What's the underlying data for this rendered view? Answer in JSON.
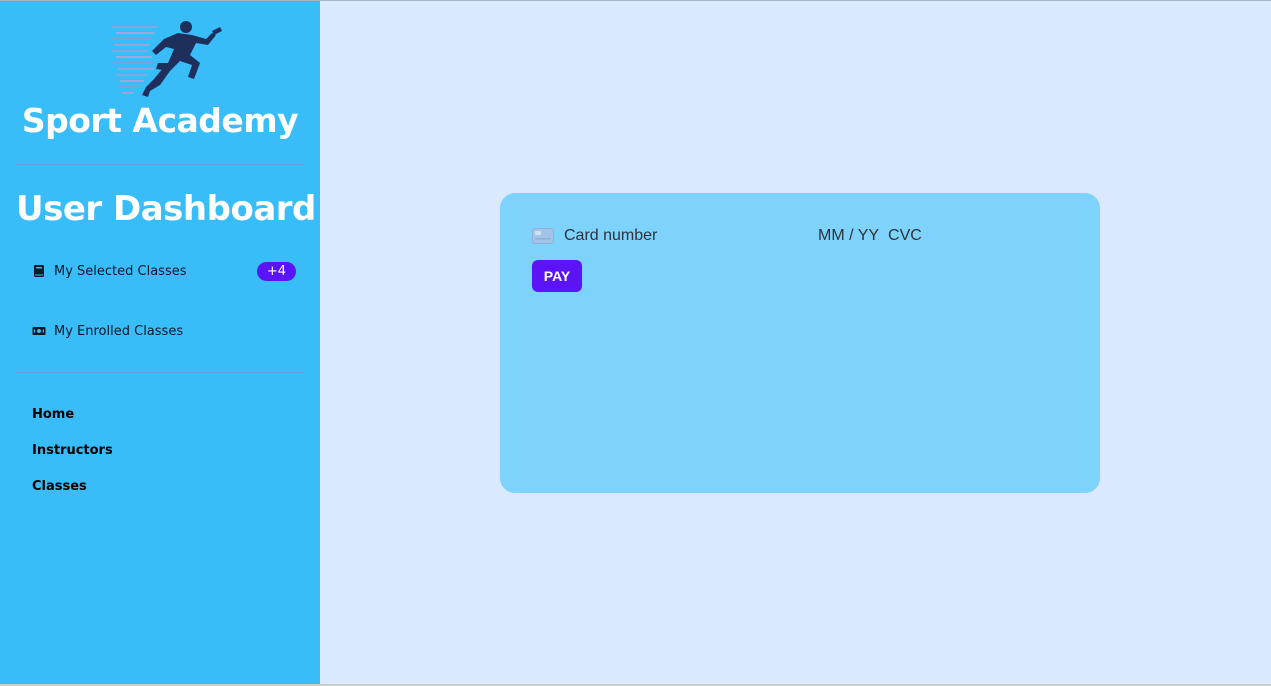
{
  "sidebar": {
    "brand": "Sport Academy",
    "logo_icon": "runner-logo-icon",
    "dashboard_title": "User Dashboard",
    "menu": [
      {
        "label": "My Selected Classes",
        "icon": "book-icon",
        "badge": "+4"
      },
      {
        "label": "My Enrolled Classes",
        "icon": "ticket-icon"
      }
    ],
    "nav": [
      "Home",
      "Instructors",
      "Classes"
    ]
  },
  "payment": {
    "card_placeholder": "Card number",
    "expiry_placeholder": "MM / YY",
    "cvc_placeholder": "CVC",
    "pay_label": "PAY"
  },
  "colors": {
    "sidebar_bg": "#38bdf8",
    "page_bg": "#dbe9fe",
    "card_bg": "#7dd3fc",
    "accent": "#5b14f7"
  }
}
